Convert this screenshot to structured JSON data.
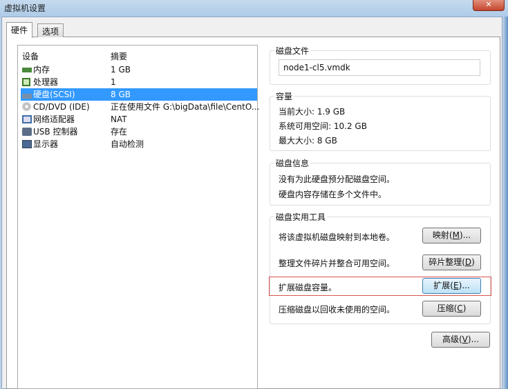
{
  "window": {
    "title": "虚拟机设置",
    "close": "✕"
  },
  "tabs": [
    {
      "label": "硬件"
    },
    {
      "label": "选项"
    }
  ],
  "devices": {
    "headers": {
      "device": "设备",
      "summary": "摘要"
    },
    "items": [
      {
        "name": "内存",
        "summary": "1 GB",
        "icon": "memory-icon"
      },
      {
        "name": "处理器",
        "summary": "1",
        "icon": "processor-icon"
      },
      {
        "name": "硬盘(SCSI)",
        "summary": "8 GB",
        "icon": "harddisk-icon",
        "selected": true
      },
      {
        "name": "CD/DVD (IDE)",
        "summary": "正在使用文件 G:\\bigData\\file\\CentO...",
        "icon": "cd-dvd-icon"
      },
      {
        "name": "网络适配器",
        "summary": "NAT",
        "icon": "network-icon"
      },
      {
        "name": "USB 控制器",
        "summary": "存在",
        "icon": "usb-icon"
      },
      {
        "name": "显示器",
        "summary": "自动检测",
        "icon": "display-icon"
      }
    ]
  },
  "disk_file": {
    "legend": "磁盘文件",
    "value": "node1-cl5.vmdk"
  },
  "capacity": {
    "legend": "容量",
    "current": "当前大小: 1.9 GB",
    "available": "系统可用空间: 10.2 GB",
    "max": "最大大小: 8 GB"
  },
  "disk_info": {
    "legend": "磁盘信息",
    "line1": "没有为此硬盘预分配磁盘空间。",
    "line2": "硬盘内容存储在多个文件中。"
  },
  "utilities": {
    "legend": "磁盘实用工具",
    "map": {
      "desc": "将该虚拟机磁盘映射到本地卷。",
      "btn": "映射(",
      "key": "M",
      "end": ")..."
    },
    "defrag": {
      "desc": "整理文件碎片并整合可用空间。",
      "btn": "碎片整理(",
      "key": "D",
      "end": ")"
    },
    "expand": {
      "desc": "扩展磁盘容量。",
      "btn": "扩展(",
      "key": "E",
      "end": ")..."
    },
    "compact": {
      "desc": "压缩磁盘以回收未使用的空间。",
      "btn": "压缩(",
      "key": "C",
      "end": ")"
    }
  },
  "advanced": {
    "btn": "高级(",
    "key": "V",
    "end": ")..."
  },
  "colors": {
    "selection": "#3399ff",
    "highlight_box": "#d9534f"
  }
}
